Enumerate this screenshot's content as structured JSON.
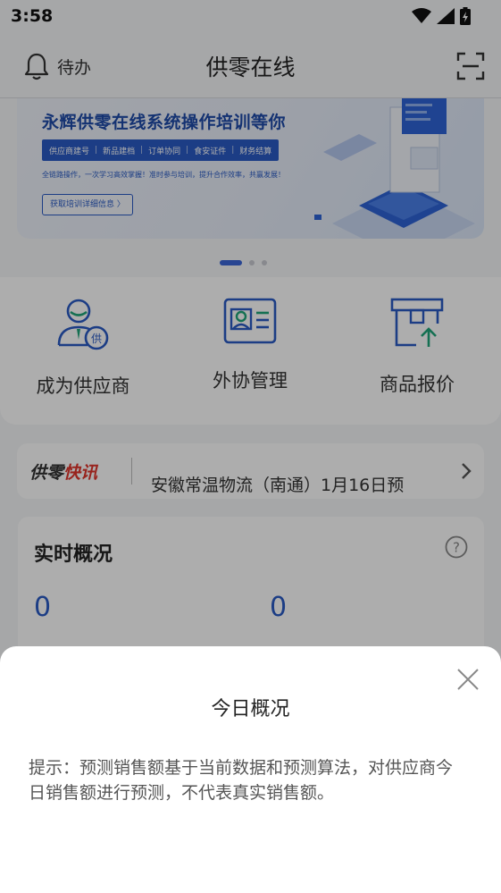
{
  "status_bar": {
    "time": "3:58"
  },
  "header": {
    "todo_label": "待办",
    "title": "供零在线"
  },
  "banner": {
    "title": "永辉供零在线系统操作培训等你",
    "tags": [
      "供应商建号",
      "新品建档",
      "订单协同",
      "食安证件",
      "财务结算"
    ],
    "description": "全链路操作，一次学习高效掌握！准时参与培训，提升合作效率，共赢发展！",
    "button_label": "获取培训详细信息 〉"
  },
  "carousel": {
    "count": 3,
    "active": 0
  },
  "actions": [
    {
      "label": "成为供应商",
      "icon": "become-supplier-icon"
    },
    {
      "label": "外协管理",
      "icon": "outsourcing-icon"
    },
    {
      "label": "商品报价",
      "icon": "product-quote-icon"
    }
  ],
  "news": {
    "logo_part1": "供零",
    "logo_part2": "快讯",
    "text": "安徽常温物流（南通）1月16日预"
  },
  "realtime": {
    "title": "实时概况",
    "value_left": "0",
    "value_right": "0"
  },
  "sheet": {
    "title": "今日概况",
    "tip": "提示：预测销售额基于当前数据和预测算法，对供应商今日销售额进行预测，不代表真实销售额。"
  },
  "colors": {
    "accent": "#2a5bc4",
    "icon_teal": "#1fa67a",
    "news_red": "#e0342c"
  }
}
